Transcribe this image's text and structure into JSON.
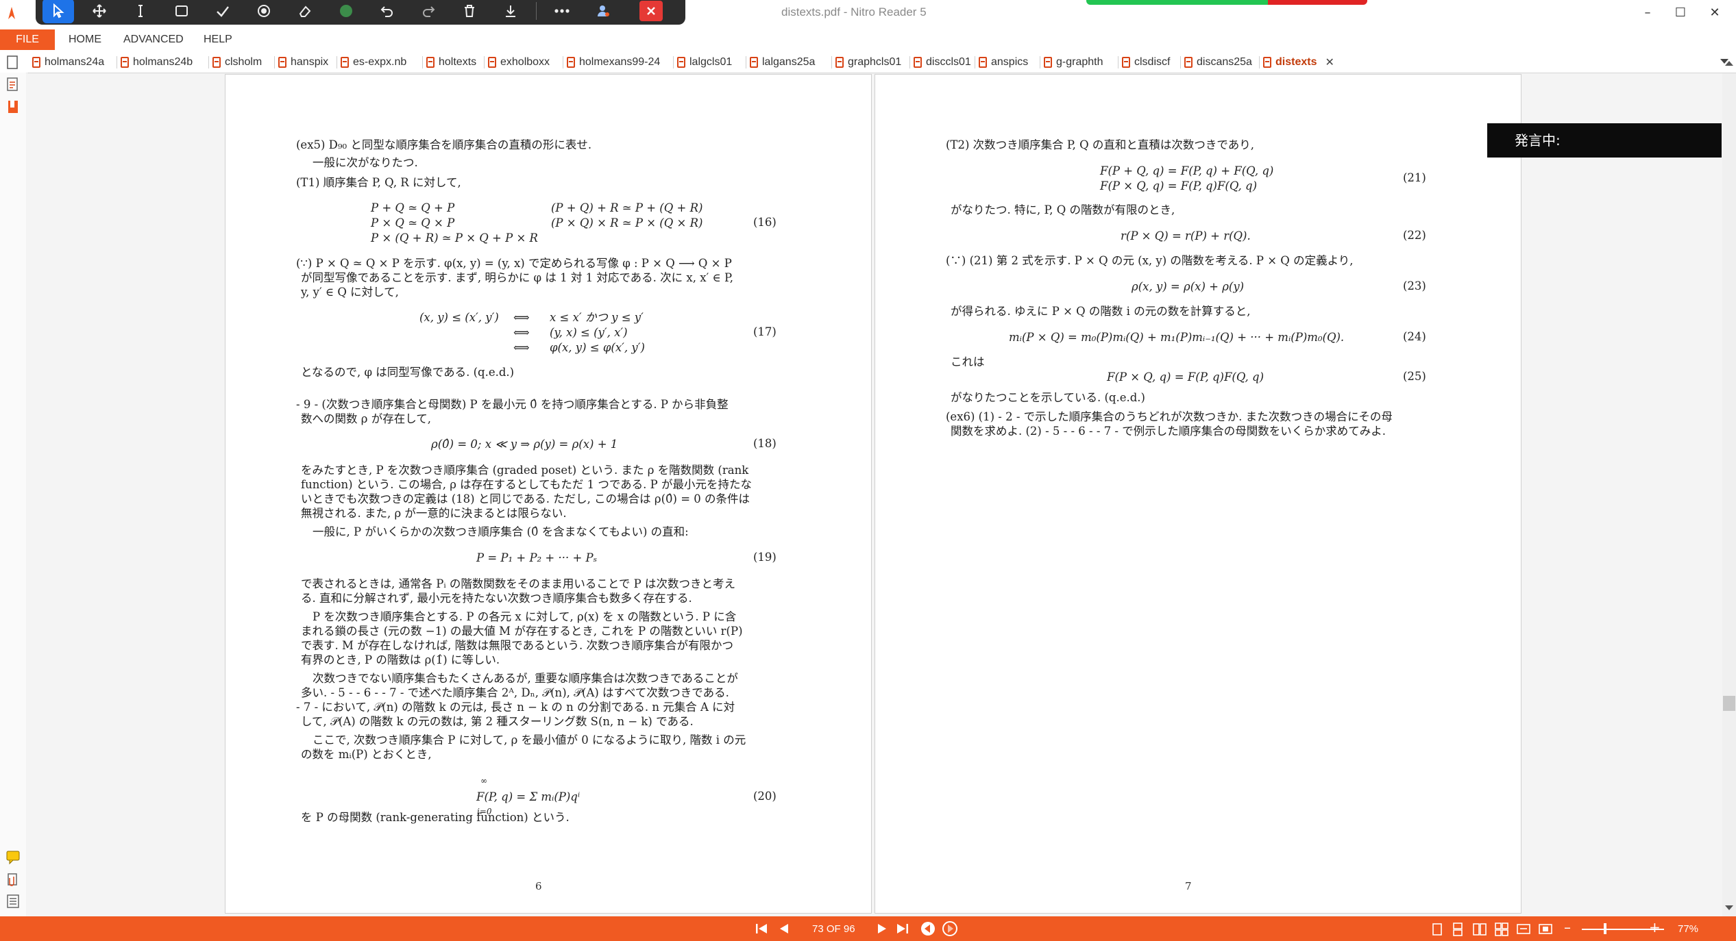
{
  "window": {
    "title": "distexts.pdf - Nitro Reader 5",
    "minimize": "–",
    "maximize": "☐",
    "close": "✕"
  },
  "toolbar": {
    "icons": [
      "select-pointer-icon",
      "pan-icon",
      "text-select-icon",
      "rectangle-icon",
      "check-icon",
      "stamp-icon",
      "eraser-icon",
      "color-dot-icon",
      "undo-icon",
      "redo-icon",
      "trash-icon",
      "download-icon",
      "more-icon",
      "user-icon",
      "close-icon"
    ],
    "accent": "#1e73e8",
    "close_color": "#e53935"
  },
  "menu": {
    "file": "FILE",
    "home": "HOME",
    "advanced": "ADVANCED",
    "help": "HELP"
  },
  "tabs": [
    "holmans24a",
    "holmans24b",
    "clsholm",
    "hanspix",
    "es-expx.nb",
    "holtexts",
    "exholboxx",
    "holmexans99-24",
    "lalgcls01",
    "lalgans25a",
    "graphcls01",
    "disccls01",
    "anspics",
    "g-graphth",
    "clsdiscf",
    "discans25a",
    "distexts"
  ],
  "active_tab": "distexts",
  "popup": {
    "speaking": "発言中:"
  },
  "status": {
    "page_counter": "73 OF 96",
    "zoom": "77%",
    "zoom_minus": "–",
    "zoom_plus": "+",
    "bar_color": "#f05a22"
  },
  "left_page": {
    "number": "6",
    "lines": [
      "(ex5)  D₉₀ と同型な順序集合を順序集合の直積の形に表せ.",
      "一般に次がなりたつ.",
      "(T1)  順序集合 P, Q, R に対して,",
      "(∵)  P × Q ≃ Q × P を示す.  φ(x, y) = (y, x) で定められる写像 φ : P × Q ⟶ Q × P",
      "が同型写像であることを示す.  まず, 明らかに φ は 1 対 1 対応である.  次に x, x′ ∈ P,",
      "y, y′ ∈ Q に対して,",
      "となるので, φ は同型写像である.  (q.e.d.)",
      "- 9 - (次数つき順序集合と母関数)  P を最小元 0̂ を持つ順序集合とする.  P から非負整",
      "数への関数 ρ が存在して,",
      "をみたすとき, P を次数つき順序集合 (graded poset) という.  また ρ を階数関数 (rank",
      "function) という.  この場合, ρ は存在するとしてもただ 1 つである.  P が最小元を持たな",
      "いときでも次数つきの定義は (18) と同じである.  ただし, この場合は ρ(0̂) = 0 の条件は",
      "無視される.  また, ρ が一意的に決まるとは限らない.",
      "一般に, P がいくらかの次数つき順序集合 (0̂ を含まなくてもよい) の直和:",
      "で表されるときは, 通常各 Pᵢ の階数関数をそのまま用いることで P は次数つきと考え",
      "る.  直和に分解されず, 最小元を持たない次数つき順序集合も数多く存在する.",
      "P を次数つき順序集合とする.  P の各元 x に対して, ρ(x) を x の階数という.  P に含",
      "まれる鎖の長さ (元の数 −1) の最大値 M が存在するとき, これを P の階数といい r(P)",
      "で表す.  M が存在しなければ, 階数は無限であるという.  次数つき順序集合が有限かつ",
      "有界のとき, P の階数は ρ(1̂) に等しい.",
      "次数つきでない順序集合もたくさんあるが, 重要な順序集合は次数つきであることが",
      "多い.  - 5 - - 6 - - 7 - で述べた順序集合 2ᴬ, Dₙ, 𝒫(n), 𝒫(A) はすべて次数つきである.",
      "- 7 - において, 𝒫(n) の階数 k の元は, 長さ n − k の n の分割である.  n 元集合 A に対",
      "して, 𝒫(A) の階数 k の元の数は, 第 2 種スターリング数 S(n, n − k) である.",
      "ここで, 次数つき順序集合 P に対して, ρ を最小値が 0 になるように取り, 階数 i の元",
      "の数を mᵢ(P) とおくとき,",
      "を P の母関数 (rank-generating function) という."
    ],
    "eq16": [
      "P + Q ≃ Q + P",
      "P × Q ≃ Q × P",
      "P × (Q + R) ≃ P × Q + P × R",
      "(P + Q) + R ≃ P + (Q + R)",
      "(P × Q) × R ≃ P × (Q × R)"
    ],
    "eq17": [
      "(x, y) ≤ (x′, y′)",
      "⟺",
      "⟺",
      "⟺",
      "x ≤ x′  かつ  y ≤ y′",
      "(y, x) ≤ (y′, x′)",
      "φ(x, y) ≤ φ(x′, y′)"
    ],
    "eq18": "ρ(0̂) = 0;        x ≪ y ⇒ ρ(y) = ρ(x) + 1",
    "eq19": "P = P₁ + P₂ + ··· + Pₛ",
    "eq20": "F(P, q) = Σ mᵢ(P)qⁱ",
    "eq20_sum_top": "∞",
    "eq20_sum_bottom": "i=0",
    "tags": [
      "(16)",
      "(17)",
      "(18)",
      "(19)",
      "(20)"
    ]
  },
  "right_page": {
    "number": "7",
    "lines": [
      "(T2)  次数つき順序集合 P, Q の直和と直積は次数つきであり,",
      "がなりたつ.  特に, P, Q の階数が有限のとき,",
      "(∵)  (21) 第 2 式を示す.  P × Q の元 (x, y) の階数を考える.  P × Q の定義より,",
      "が得られる.  ゆえに P × Q の階数 i の元の数を計算すると,",
      "これは",
      "がなりたつことを示している.  (q.e.d.)",
      "(ex6)  (1) - 2 - で示した順序集合のうちどれが次数つきか.  また次数つきの場合にその母",
      "関数を求めよ.  (2) - 5 - - 6 - - 7 - で例示した順序集合の母関数をいくらか求めてみよ."
    ],
    "eq21": [
      "F(P + Q, q) = F(P, q) + F(Q, q)",
      "F(P × Q, q) = F(P, q)F(Q, q)"
    ],
    "eq22": "r(P × Q) = r(P) + r(Q).",
    "eq23": "ρ(x, y) = ρ(x) + ρ(y)",
    "eq24": "mᵢ(P × Q) = m₀(P)mᵢ(Q) + m₁(P)mᵢ₋₁(Q) + ··· + mᵢ(P)m₀(Q).",
    "eq25": "F(P × Q, q) = F(P, q)F(Q, q)",
    "tags": [
      "(21)",
      "(22)",
      "(23)",
      "(24)",
      "(25)"
    ]
  }
}
